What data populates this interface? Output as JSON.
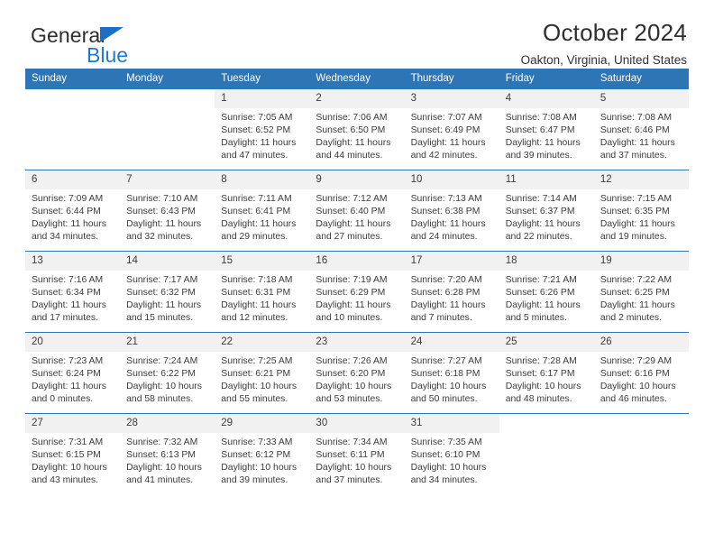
{
  "brand": {
    "name_part1": "General",
    "name_part2": "Blue",
    "accent_color": "#1b7ad4",
    "triangle_color": "#1b6fc4"
  },
  "header": {
    "title": "October 2024",
    "location": "Oakton, Virginia, United States"
  },
  "theme": {
    "header_band": "#2e75b6",
    "day_band": "#f1f1f1",
    "text": "#3b3b3b"
  },
  "weekday_headers": [
    "Sunday",
    "Monday",
    "Tuesday",
    "Wednesday",
    "Thursday",
    "Friday",
    "Saturday"
  ],
  "weeks": [
    [
      {
        "day": "",
        "sunrise": "",
        "sunset": "",
        "daylight": "",
        "blank": true
      },
      {
        "day": "",
        "sunrise": "",
        "sunset": "",
        "daylight": "",
        "blank": true
      },
      {
        "day": "1",
        "sunrise": "Sunrise: 7:05 AM",
        "sunset": "Sunset: 6:52 PM",
        "daylight": "Daylight: 11 hours and 47 minutes."
      },
      {
        "day": "2",
        "sunrise": "Sunrise: 7:06 AM",
        "sunset": "Sunset: 6:50 PM",
        "daylight": "Daylight: 11 hours and 44 minutes."
      },
      {
        "day": "3",
        "sunrise": "Sunrise: 7:07 AM",
        "sunset": "Sunset: 6:49 PM",
        "daylight": "Daylight: 11 hours and 42 minutes."
      },
      {
        "day": "4",
        "sunrise": "Sunrise: 7:08 AM",
        "sunset": "Sunset: 6:47 PM",
        "daylight": "Daylight: 11 hours and 39 minutes."
      },
      {
        "day": "5",
        "sunrise": "Sunrise: 7:08 AM",
        "sunset": "Sunset: 6:46 PM",
        "daylight": "Daylight: 11 hours and 37 minutes."
      }
    ],
    [
      {
        "day": "6",
        "sunrise": "Sunrise: 7:09 AM",
        "sunset": "Sunset: 6:44 PM",
        "daylight": "Daylight: 11 hours and 34 minutes."
      },
      {
        "day": "7",
        "sunrise": "Sunrise: 7:10 AM",
        "sunset": "Sunset: 6:43 PM",
        "daylight": "Daylight: 11 hours and 32 minutes."
      },
      {
        "day": "8",
        "sunrise": "Sunrise: 7:11 AM",
        "sunset": "Sunset: 6:41 PM",
        "daylight": "Daylight: 11 hours and 29 minutes."
      },
      {
        "day": "9",
        "sunrise": "Sunrise: 7:12 AM",
        "sunset": "Sunset: 6:40 PM",
        "daylight": "Daylight: 11 hours and 27 minutes."
      },
      {
        "day": "10",
        "sunrise": "Sunrise: 7:13 AM",
        "sunset": "Sunset: 6:38 PM",
        "daylight": "Daylight: 11 hours and 24 minutes."
      },
      {
        "day": "11",
        "sunrise": "Sunrise: 7:14 AM",
        "sunset": "Sunset: 6:37 PM",
        "daylight": "Daylight: 11 hours and 22 minutes."
      },
      {
        "day": "12",
        "sunrise": "Sunrise: 7:15 AM",
        "sunset": "Sunset: 6:35 PM",
        "daylight": "Daylight: 11 hours and 19 minutes."
      }
    ],
    [
      {
        "day": "13",
        "sunrise": "Sunrise: 7:16 AM",
        "sunset": "Sunset: 6:34 PM",
        "daylight": "Daylight: 11 hours and 17 minutes."
      },
      {
        "day": "14",
        "sunrise": "Sunrise: 7:17 AM",
        "sunset": "Sunset: 6:32 PM",
        "daylight": "Daylight: 11 hours and 15 minutes."
      },
      {
        "day": "15",
        "sunrise": "Sunrise: 7:18 AM",
        "sunset": "Sunset: 6:31 PM",
        "daylight": "Daylight: 11 hours and 12 minutes."
      },
      {
        "day": "16",
        "sunrise": "Sunrise: 7:19 AM",
        "sunset": "Sunset: 6:29 PM",
        "daylight": "Daylight: 11 hours and 10 minutes."
      },
      {
        "day": "17",
        "sunrise": "Sunrise: 7:20 AM",
        "sunset": "Sunset: 6:28 PM",
        "daylight": "Daylight: 11 hours and 7 minutes."
      },
      {
        "day": "18",
        "sunrise": "Sunrise: 7:21 AM",
        "sunset": "Sunset: 6:26 PM",
        "daylight": "Daylight: 11 hours and 5 minutes."
      },
      {
        "day": "19",
        "sunrise": "Sunrise: 7:22 AM",
        "sunset": "Sunset: 6:25 PM",
        "daylight": "Daylight: 11 hours and 2 minutes."
      }
    ],
    [
      {
        "day": "20",
        "sunrise": "Sunrise: 7:23 AM",
        "sunset": "Sunset: 6:24 PM",
        "daylight": "Daylight: 11 hours and 0 minutes."
      },
      {
        "day": "21",
        "sunrise": "Sunrise: 7:24 AM",
        "sunset": "Sunset: 6:22 PM",
        "daylight": "Daylight: 10 hours and 58 minutes."
      },
      {
        "day": "22",
        "sunrise": "Sunrise: 7:25 AM",
        "sunset": "Sunset: 6:21 PM",
        "daylight": "Daylight: 10 hours and 55 minutes."
      },
      {
        "day": "23",
        "sunrise": "Sunrise: 7:26 AM",
        "sunset": "Sunset: 6:20 PM",
        "daylight": "Daylight: 10 hours and 53 minutes."
      },
      {
        "day": "24",
        "sunrise": "Sunrise: 7:27 AM",
        "sunset": "Sunset: 6:18 PM",
        "daylight": "Daylight: 10 hours and 50 minutes."
      },
      {
        "day": "25",
        "sunrise": "Sunrise: 7:28 AM",
        "sunset": "Sunset: 6:17 PM",
        "daylight": "Daylight: 10 hours and 48 minutes."
      },
      {
        "day": "26",
        "sunrise": "Sunrise: 7:29 AM",
        "sunset": "Sunset: 6:16 PM",
        "daylight": "Daylight: 10 hours and 46 minutes."
      }
    ],
    [
      {
        "day": "27",
        "sunrise": "Sunrise: 7:31 AM",
        "sunset": "Sunset: 6:15 PM",
        "daylight": "Daylight: 10 hours and 43 minutes."
      },
      {
        "day": "28",
        "sunrise": "Sunrise: 7:32 AM",
        "sunset": "Sunset: 6:13 PM",
        "daylight": "Daylight: 10 hours and 41 minutes."
      },
      {
        "day": "29",
        "sunrise": "Sunrise: 7:33 AM",
        "sunset": "Sunset: 6:12 PM",
        "daylight": "Daylight: 10 hours and 39 minutes."
      },
      {
        "day": "30",
        "sunrise": "Sunrise: 7:34 AM",
        "sunset": "Sunset: 6:11 PM",
        "daylight": "Daylight: 10 hours and 37 minutes."
      },
      {
        "day": "31",
        "sunrise": "Sunrise: 7:35 AM",
        "sunset": "Sunset: 6:10 PM",
        "daylight": "Daylight: 10 hours and 34 minutes."
      },
      {
        "day": "",
        "sunrise": "",
        "sunset": "",
        "daylight": "",
        "blank": true
      },
      {
        "day": "",
        "sunrise": "",
        "sunset": "",
        "daylight": "",
        "blank": true
      }
    ]
  ]
}
